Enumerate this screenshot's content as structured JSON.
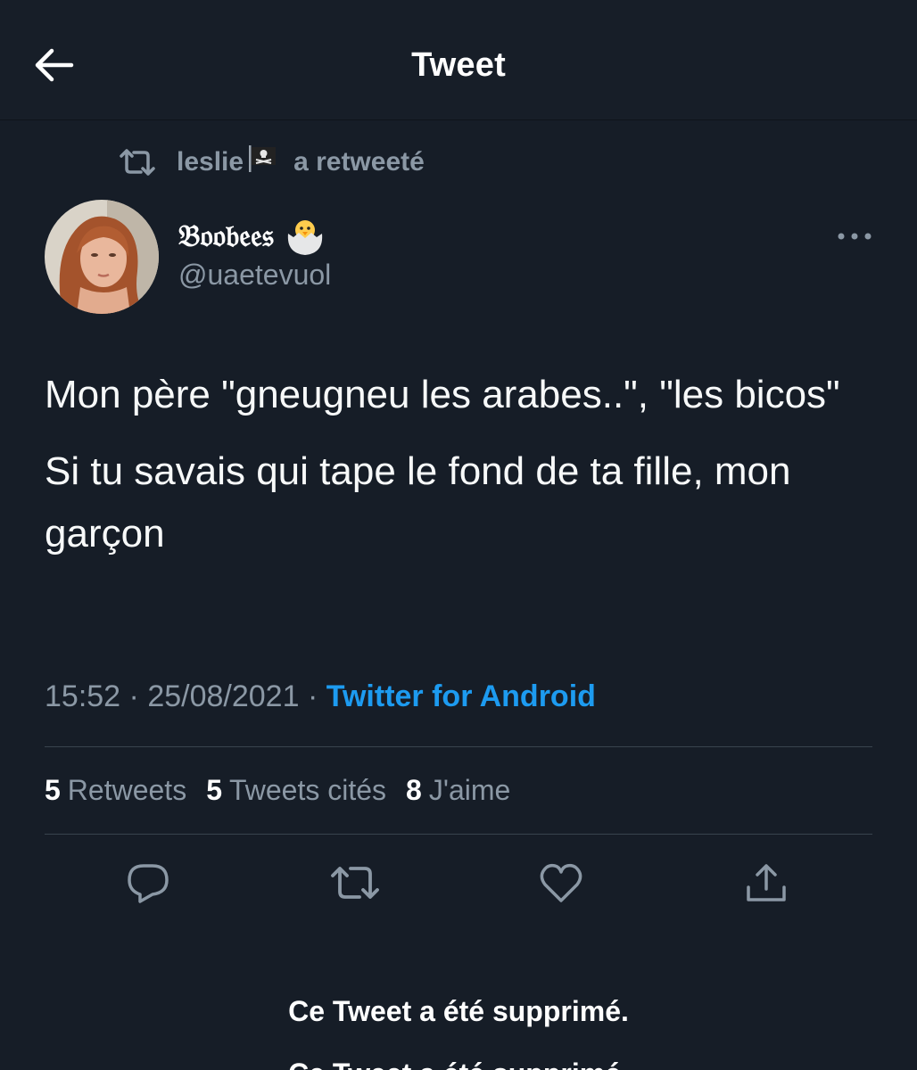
{
  "header": {
    "title": "Tweet",
    "back_icon": "arrow-left-icon"
  },
  "retweet": {
    "user": "leslie",
    "flag_icon": "pirate-flag-icon",
    "suffix": "a retweeté",
    "icon": "retweet-icon"
  },
  "author": {
    "display_name": "𝔅𝔬𝔬𝔟𝔢𝔢𝔰",
    "badge_icon": "hatching-chick-icon",
    "handle": "@uaetevuol",
    "more_icon": "more-dots-icon"
  },
  "tweet": {
    "paragraphs": [
      "Mon père \"gneugneu les arabes..\", \"les bicos\"",
      "Si tu savais qui tape le fond de ta fille, mon garçon"
    ]
  },
  "meta": {
    "time": "15:52",
    "date": "25/08/2021",
    "separator": "·",
    "source": "Twitter for Android"
  },
  "stats": {
    "retweets_count": "5",
    "retweets_label": "Retweets",
    "quotes_count": "5",
    "quotes_label": "Tweets cités",
    "likes_count": "8",
    "likes_label": "J'aime"
  },
  "actions": [
    "reply-icon",
    "retweet-icon",
    "like-icon",
    "share-icon"
  ],
  "deleted": {
    "line1": "Ce Tweet a été supprimé.",
    "line2": "Ce Tweet a été supprimé."
  },
  "colors": {
    "background": "#161d27",
    "text_secondary": "#8b98a5",
    "accent": "#1d9bf0",
    "divider": "#38444d"
  }
}
